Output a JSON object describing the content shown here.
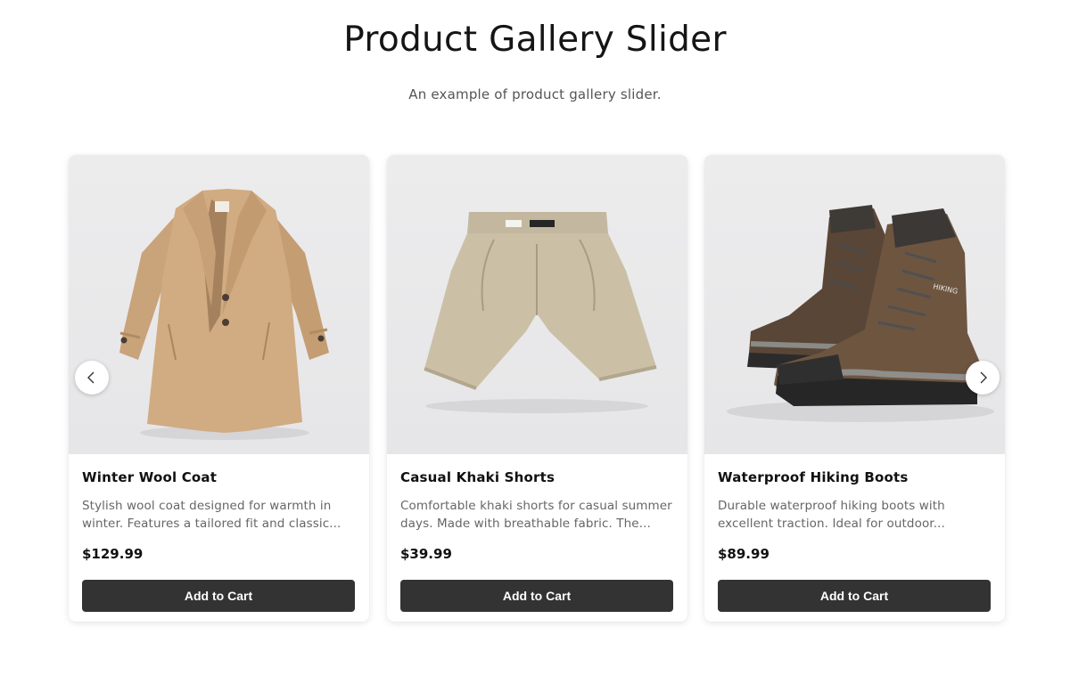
{
  "header": {
    "title": "Product Gallery Slider",
    "subtitle": "An example of product gallery slider."
  },
  "slider": {
    "prev_icon": "chevron-left-icon",
    "next_icon": "chevron-right-icon",
    "products": [
      {
        "name": "Winter Wool Coat",
        "description": "Stylish wool coat designed for warmth in winter. Features a tailored fit and classic...",
        "price": "$129.99",
        "button_label": "Add to Cart",
        "image": "winter-wool-coat-photo"
      },
      {
        "name": "Casual Khaki Shorts",
        "description": "Comfortable khaki shorts for casual summer days. Made with breathable fabric. The...",
        "price": "$39.99",
        "button_label": "Add to Cart",
        "image": "khaki-shorts-photo"
      },
      {
        "name": "Waterproof Hiking Boots",
        "description": "Durable waterproof hiking boots with excellent traction. Ideal for outdoor...",
        "price": "$89.99",
        "button_label": "Add to Cart",
        "image": "hiking-boots-photo"
      }
    ]
  },
  "colors": {
    "button_bg": "#333333",
    "button_text": "#ffffff",
    "title_text": "#151515",
    "desc_text": "#666666"
  }
}
